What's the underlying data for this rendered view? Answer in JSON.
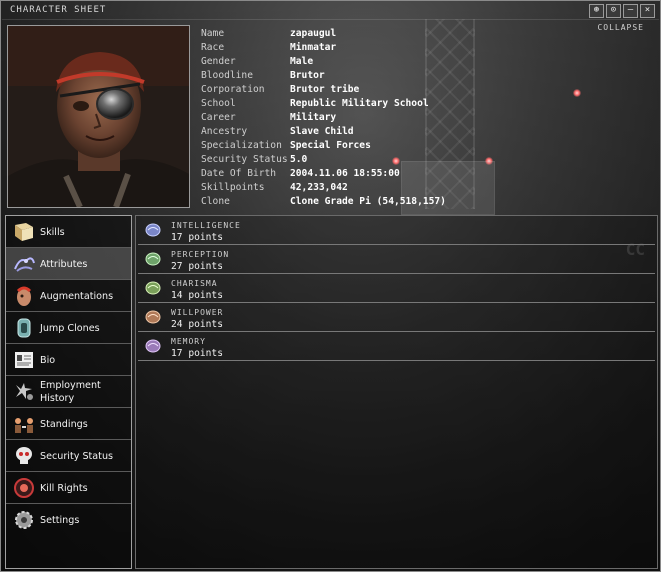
{
  "window": {
    "title": "CHARACTER SHEET",
    "collapse_label": "COLLAPSE",
    "buttons": [
      {
        "name": "pin-icon",
        "glyph": "⊛"
      },
      {
        "name": "options-icon",
        "glyph": "⊙"
      },
      {
        "name": "minimize-icon",
        "glyph": "–"
      },
      {
        "name": "close-icon",
        "glyph": "×"
      }
    ]
  },
  "character": {
    "rows": [
      {
        "label": "Name",
        "value": "zapaugul"
      },
      {
        "label": "Race",
        "value": "Minmatar"
      },
      {
        "label": "Gender",
        "value": "Male"
      },
      {
        "label": "Bloodline",
        "value": "Brutor"
      },
      {
        "label": "Corporation",
        "value": "Brutor tribe"
      },
      {
        "label": "School",
        "value": "Republic Military School"
      },
      {
        "label": "Career",
        "value": "Military"
      },
      {
        "label": "Ancestry",
        "value": "Slave Child"
      },
      {
        "label": "Specialization",
        "value": "Special Forces"
      },
      {
        "label": "Security Status",
        "value": "5.0"
      },
      {
        "label": "Date Of Birth",
        "value": "2004.11.06 18:55:00"
      },
      {
        "label": "Skillpoints",
        "value": "42,233,042"
      },
      {
        "label": "Clone",
        "value": "Clone Grade Pi (54,518,157)"
      }
    ]
  },
  "sidebar": {
    "items": [
      {
        "label": "Skills",
        "icon": "book-icon",
        "active": false
      },
      {
        "label": "Attributes",
        "icon": "brain-icon",
        "active": true
      },
      {
        "label": "Augmentations",
        "icon": "implant-head-icon",
        "active": false
      },
      {
        "label": "Jump Clones",
        "icon": "clone-pod-icon",
        "active": false
      },
      {
        "label": "Bio",
        "icon": "document-icon",
        "active": false
      },
      {
        "label": "Employment History",
        "icon": "medal-icon",
        "active": false
      },
      {
        "label": "Standings",
        "icon": "standings-icon",
        "active": false
      },
      {
        "label": "Security Status",
        "icon": "skull-icon",
        "active": false
      },
      {
        "label": "Kill Rights",
        "icon": "target-icon",
        "active": false
      },
      {
        "label": "Settings",
        "icon": "gear-icon",
        "active": false
      }
    ]
  },
  "attributes": [
    {
      "name": "INTELLIGENCE",
      "points": "17 points",
      "icon": "intelligence-icon",
      "color": "#7a86c8"
    },
    {
      "name": "PERCEPTION",
      "points": "27 points",
      "icon": "perception-icon",
      "color": "#6ea36a"
    },
    {
      "name": "CHARISMA",
      "points": "14 points",
      "icon": "charisma-icon",
      "color": "#7aa05a"
    },
    {
      "name": "WILLPOWER",
      "points": "24 points",
      "icon": "willpower-icon",
      "color": "#b07a58"
    },
    {
      "name": "MEMORY",
      "points": "17 points",
      "icon": "memory-icon",
      "color": "#9a7ab8"
    }
  ]
}
